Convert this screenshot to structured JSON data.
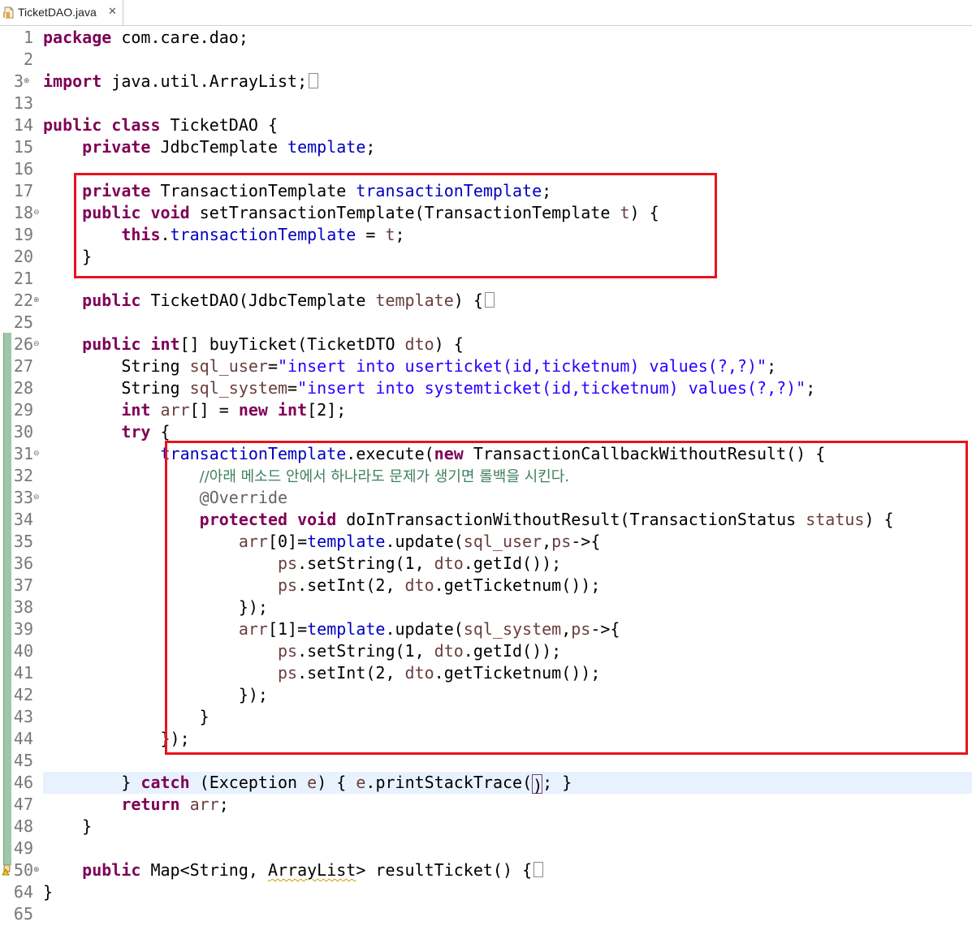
{
  "tab": {
    "title": "TicketDAO.java",
    "close_glyph": "✕",
    "icon": "java-file-icon"
  },
  "colors": {
    "keyword": "#7f0055",
    "field": "#0000c0",
    "string": "#2a00ff",
    "comment": "#3f7f5f",
    "annotation": "#646464",
    "highlight_box": "#e8141c"
  },
  "line_numbers": [
    "1",
    "2",
    "3",
    "13",
    "14",
    "15",
    "16",
    "17",
    "18",
    "19",
    "20",
    "21",
    "22",
    "25",
    "26",
    "27",
    "28",
    "29",
    "30",
    "31",
    "32",
    "33",
    "34",
    "35",
    "36",
    "37",
    "38",
    "39",
    "40",
    "41",
    "42",
    "43",
    "44",
    "45",
    "46",
    "47",
    "48",
    "49",
    "50",
    "64",
    "65"
  ],
  "code": {
    "l1": {
      "kw": "package",
      "rest": " com.care.dao;"
    },
    "l3": {
      "kw": "import",
      "rest": " java.util.ArrayList;"
    },
    "l14": {
      "kw": "public class",
      "rest": " TicketDAO {"
    },
    "l15": {
      "kw": "private",
      "type": " JdbcTemplate ",
      "field": "template",
      "end": ";"
    },
    "l17": {
      "kw": "private",
      "type": " TransactionTemplate ",
      "field": "transactionTemplate",
      "end": ";"
    },
    "l18": {
      "kw": "public void",
      "rest": " setTransactionTemplate(TransactionTemplate ",
      "var": "t",
      "end": ") {"
    },
    "l19": {
      "kw": "this",
      "dot": ".",
      "field": "transactionTemplate",
      "mid": " = ",
      "var": "t",
      "end": ";"
    },
    "l20": {
      "rest": "}"
    },
    "l22": {
      "kw": "public",
      "rest": " TicketDAO(JdbcTemplate ",
      "var": "template",
      "end": ") {"
    },
    "l26": {
      "kw1": "public",
      "kw2": "int",
      "rest": "[] buyTicket(TicketDTO ",
      "var": "dto",
      "end": ") {"
    },
    "l27": {
      "type": "String ",
      "var": "sql_user",
      "eq": "=",
      "str": "\"insert into userticket(id,ticketnum) values(?,?)\"",
      "end": ";"
    },
    "l28": {
      "type": "String ",
      "var": "sql_system",
      "eq": "=",
      "str": "\"insert into systemticket(id,ticketnum) values(?,?)\"",
      "end": ";"
    },
    "l29": {
      "kw1": "int",
      "var": " arr",
      "mid": "[] = ",
      "kw2": "new",
      "kw3": " int",
      "end": "[2];"
    },
    "l30": {
      "kw": "try",
      "rest": " {"
    },
    "l31": {
      "field": "transactionTemplate",
      "mid": ".execute(",
      "kw": "new",
      "rest": " TransactionCallbackWithoutResult() {"
    },
    "l32": {
      "comment": "//아래 메소드 안에서 하나라도 문제가 생기면 롤백을 시킨다."
    },
    "l33": {
      "ann": "@Override"
    },
    "l34": {
      "kw": "protected void",
      "rest": " doInTransactionWithoutResult(TransactionStatus ",
      "var": "status",
      "end": ") {"
    },
    "l35": {
      "var": "arr",
      "mid": "[0]=",
      "field": "template",
      "rest": ".update(",
      "var2": "sql_user",
      "rest2": ",",
      "var3": "ps",
      "end": "->{"
    },
    "l36": {
      "var": "ps",
      "rest": ".setString(1, ",
      "var2": "dto",
      "end": ".getId());"
    },
    "l37": {
      "var": "ps",
      "rest": ".setInt(2, ",
      "var2": "dto",
      "end": ".getTicketnum());"
    },
    "l38": {
      "rest": "});"
    },
    "l39": {
      "var": "arr",
      "mid": "[1]=",
      "field": "template",
      "rest": ".update(",
      "var2": "sql_system",
      "rest2": ",",
      "var3": "ps",
      "end": "->{"
    },
    "l40": {
      "var": "ps",
      "rest": ".setString(1, ",
      "var2": "dto",
      "end": ".getId());"
    },
    "l41": {
      "var": "ps",
      "rest": ".setInt(2, ",
      "var2": "dto",
      "end": ".getTicketnum());"
    },
    "l42": {
      "rest": "});"
    },
    "l43": {
      "rest": "}"
    },
    "l44": {
      "rest": "});"
    },
    "l46": {
      "pre": "} ",
      "kw": "catch",
      "mid": " (Exception ",
      "var": "e",
      "mid2": ") { ",
      "var2": "e",
      "rest": ".printStackTrace(",
      "caret": ")",
      "end": "; }"
    },
    "l47": {
      "kw": "return",
      "var": " arr",
      "end": ";"
    },
    "l48": {
      "rest": "}"
    },
    "l50": {
      "kw": "public",
      "rest1": " Map<String, ",
      "squig": "ArrayList",
      "rest2": "> resultTicket() {"
    },
    "l64": {
      "rest": "}"
    }
  }
}
